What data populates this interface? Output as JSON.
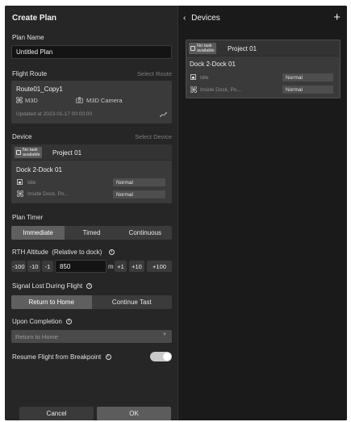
{
  "left": {
    "title": "Create Plan",
    "plan_name_label": "Plan Name",
    "plan_name_value": "Untitled Plan",
    "flight_route_label": "Flight Route",
    "select_route": "Select Route",
    "route": {
      "name": "Route01_Copy1",
      "drone": "M3D",
      "camera": "M3D Camera",
      "updated": "Updated at 2023-01-17 00:00:00"
    },
    "device_label": "Device",
    "select_device": "Select Device",
    "device": {
      "tag_line1": "No task",
      "tag_line2": "available",
      "project": "Project 01",
      "dock": "Dock 2-Dock 01",
      "row1_label": "Idle",
      "row1_status": "Normal",
      "row2_label": "Inside Dock, Po...",
      "row2_status": "Normal"
    },
    "plan_timer_label": "Plan Timer",
    "timer_options": [
      "Immediate",
      "Timed",
      "Continuous"
    ],
    "rth_label": "RTH Altitude",
    "rth_sub": "(Relative to dock)",
    "rth_minus": [
      "-100",
      "-10",
      "-1"
    ],
    "rth_value": "850",
    "rth_unit": "m",
    "rth_plus": [
      "+1",
      "+10",
      "+100"
    ],
    "signal_lost_label": "Signal Lost During Flight",
    "signal_options": [
      "Return to Home",
      "Continue Tast"
    ],
    "upon_completion_label": "Upon Completion",
    "upon_completion_value": "Return to Home",
    "resume_label": "Resume Flight from Breakpoint",
    "cancel": "Cancel",
    "ok": "OK"
  },
  "right": {
    "title": "Devices",
    "add": "+",
    "card": {
      "tag_line1": "No task",
      "tag_line2": "available",
      "project": "Project 01",
      "dock": "Dock 2-Dock 01",
      "row1_label": "Idle",
      "row1_status": "Normal",
      "row2_label": "Inside Dock, Po...",
      "row2_status": "Normal"
    }
  },
  "colors": {
    "panel": "#262626",
    "sidebar": "#1a1a1a",
    "active_segment": "#5f5f5f",
    "ok_button": "#5c5c5c"
  }
}
